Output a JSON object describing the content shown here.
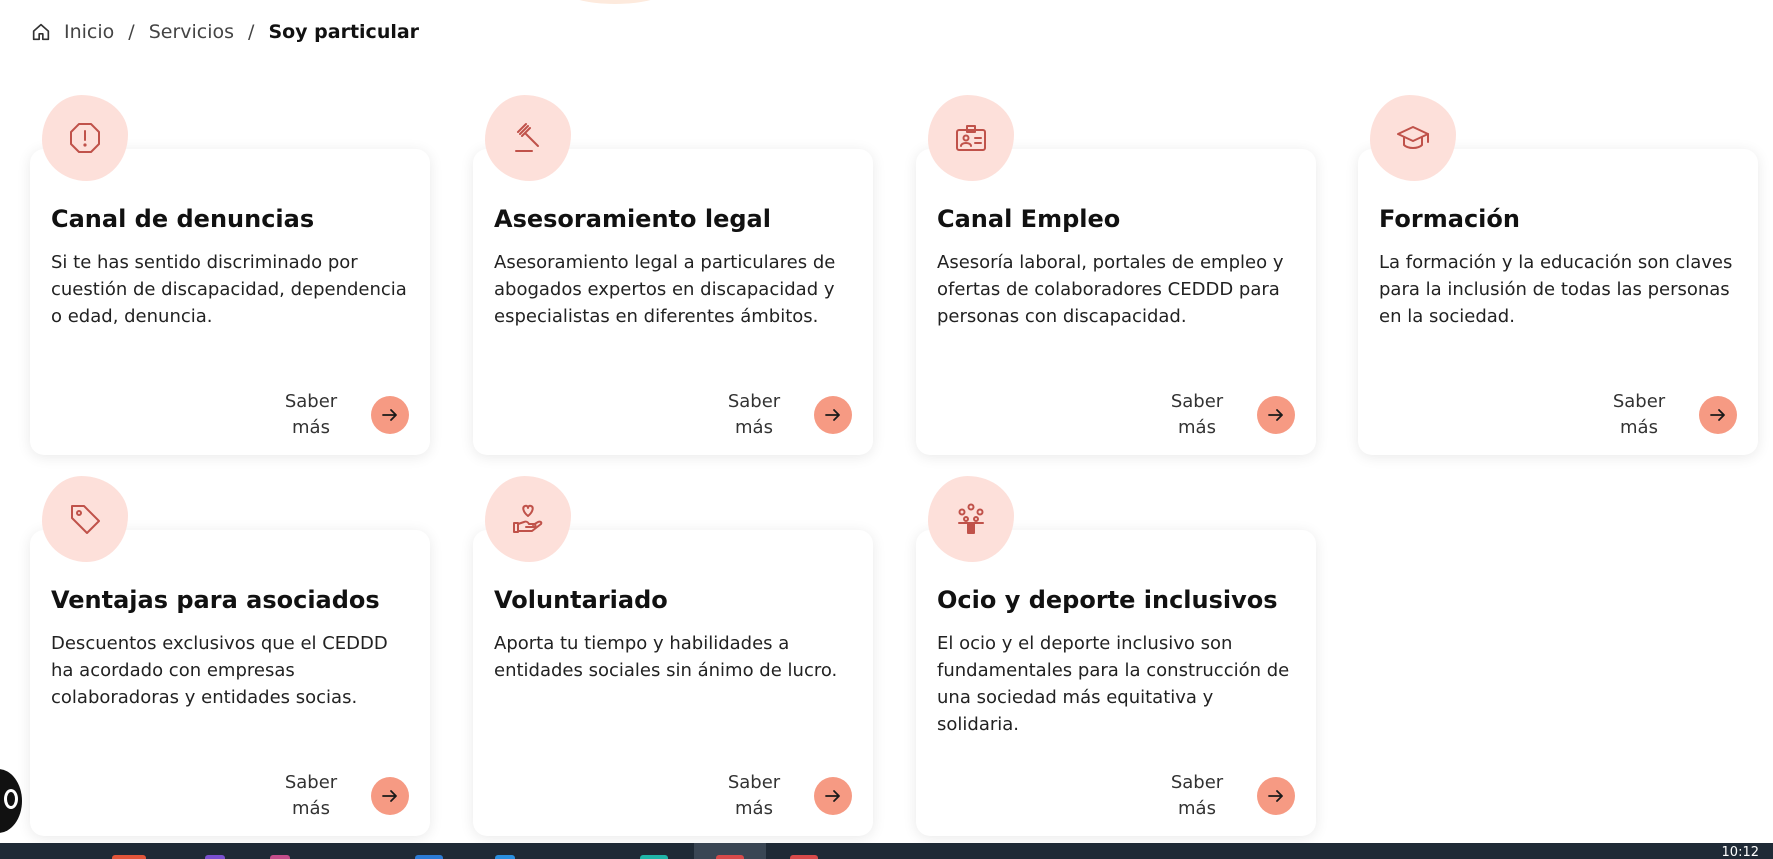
{
  "breadcrumb": {
    "home_icon": "home-icon",
    "items": [
      "Inicio",
      "Servicios"
    ],
    "separator": "/",
    "current": "Soy particular"
  },
  "cards": [
    {
      "icon": "alert-octagon-icon",
      "title": "Canal de denuncias",
      "description": "Si te has sentido discriminado por cuestión de discapacidad, dependencia o edad, denuncia.",
      "link_label": "Saber más"
    },
    {
      "icon": "gavel-icon",
      "title": "Asesoramiento legal",
      "description": "Asesoramiento legal a particulares de abogados expertos en discapacidad y especialistas en diferentes ámbitos.",
      "link_label": "Saber más"
    },
    {
      "icon": "id-card-icon",
      "title": "Canal Empleo",
      "description": "Asesoría laboral, portales de empleo y ofertas de colaboradores CEDDD para personas con discapacidad.",
      "link_label": "Saber más"
    },
    {
      "icon": "graduation-cap-icon",
      "title": "Formación",
      "description": "La formación y la educación son claves para la inclusión de todas las personas en la sociedad.",
      "link_label": "Saber más"
    },
    {
      "icon": "tag-icon",
      "title": "Ventajas para asociados",
      "description": "Descuentos exclusivos que el CEDDD ha acordado con empresas colaboradoras y entidades socias.",
      "link_label": "Saber más"
    },
    {
      "icon": "hand-heart-icon",
      "title": "Voluntariado",
      "description": "Aporta tu tiempo y habilidades a entidades sociales sin ánimo de lucro.",
      "link_label": "Saber más"
    },
    {
      "icon": "balloons-icon",
      "title": "Ocio y deporte inclusivos",
      "description": "El ocio y el deporte inclusivo son fundamentales para la construcción de una sociedad más equitativa y solidaria.",
      "link_label": "Saber más"
    }
  ],
  "colors": {
    "accent": "#f69a83",
    "badge_bg": "#fde0da",
    "icon_stroke": "#c0524a"
  },
  "taskbar": {
    "clock": "10:12"
  }
}
